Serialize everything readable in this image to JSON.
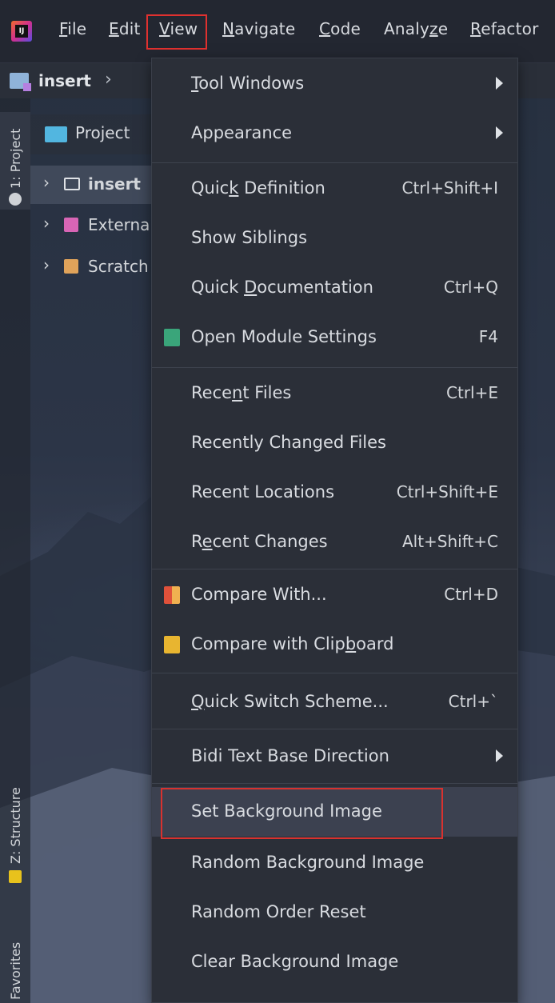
{
  "menubar": {
    "items": [
      {
        "pre": "",
        "u": "F",
        "post": "ile"
      },
      {
        "pre": "",
        "u": "E",
        "post": "dit"
      },
      {
        "pre": "",
        "u": "V",
        "post": "iew"
      },
      {
        "pre": "",
        "u": "N",
        "post": "avigate"
      },
      {
        "pre": "",
        "u": "C",
        "post": "ode"
      },
      {
        "pre": "Analy",
        "u": "z",
        "post": "e"
      },
      {
        "pre": "",
        "u": "R",
        "post": "efactor"
      }
    ]
  },
  "breadcrumb": {
    "project": "insert",
    "chevron": "›"
  },
  "left_strip": {
    "project_tab": "1: Project",
    "structure_tab": "Z: Structure",
    "favorites_tab": "Favorites"
  },
  "project_panel": {
    "header": "Project",
    "items": [
      {
        "label": "insert",
        "icon": "folder-icon"
      },
      {
        "label": "Externa",
        "icon": "library-icon"
      },
      {
        "label": "Scratch",
        "icon": "scratch-icon"
      }
    ]
  },
  "view_menu": {
    "items": [
      {
        "pre": "",
        "u": "T",
        "post": "ool Windows",
        "shortcut": "",
        "submenu": true
      },
      {
        "pre": "Appearance",
        "u": "",
        "post": "",
        "shortcut": "",
        "submenu": true
      },
      {
        "pre": "Quic",
        "u": "k",
        "post": " Definition",
        "shortcut": "Ctrl+Shift+I"
      },
      {
        "pre": "Show Siblings",
        "u": "",
        "post": "",
        "shortcut": ""
      },
      {
        "pre": "Quick ",
        "u": "D",
        "post": "ocumentation",
        "shortcut": "Ctrl+Q"
      },
      {
        "pre": "Open Module Settings",
        "u": "",
        "post": "",
        "shortcut": "F4",
        "icon": "module-settings-icon"
      },
      {
        "pre": "Rece",
        "u": "n",
        "post": "t Files",
        "shortcut": "Ctrl+E"
      },
      {
        "pre": "Recently Changed Files",
        "u": "",
        "post": "",
        "shortcut": ""
      },
      {
        "pre": "Recent Locations",
        "u": "",
        "post": "",
        "shortcut": "Ctrl+Shift+E"
      },
      {
        "pre": "R",
        "u": "e",
        "post": "cent Changes",
        "shortcut": "Alt+Shift+C"
      },
      {
        "pre": "Compare With...",
        "u": "",
        "post": "",
        "shortcut": "Ctrl+D",
        "icon": "compare-icon"
      },
      {
        "pre": "Compare with Clip",
        "u": "b",
        "post": "oard",
        "shortcut": "",
        "icon": "clipboard-compare-icon"
      },
      {
        "pre": "",
        "u": "Q",
        "post": "uick Switch Scheme...",
        "shortcut": "Ctrl+`"
      },
      {
        "pre": "Bidi Text Base Direction",
        "u": "",
        "post": "",
        "shortcut": "",
        "submenu": true
      },
      {
        "pre": "Set Background Image",
        "u": "",
        "post": "",
        "shortcut": ""
      },
      {
        "pre": "Random Background Image",
        "u": "",
        "post": "",
        "shortcut": ""
      },
      {
        "pre": "Random Order Reset",
        "u": "",
        "post": "",
        "shortcut": ""
      },
      {
        "pre": "Clear Background Image",
        "u": "",
        "post": "",
        "shortcut": ""
      }
    ]
  },
  "colors": {
    "highlight_box": "#e0312f",
    "menu_bg": "#2b2f38",
    "selected_item_bg": "#3c4150"
  }
}
